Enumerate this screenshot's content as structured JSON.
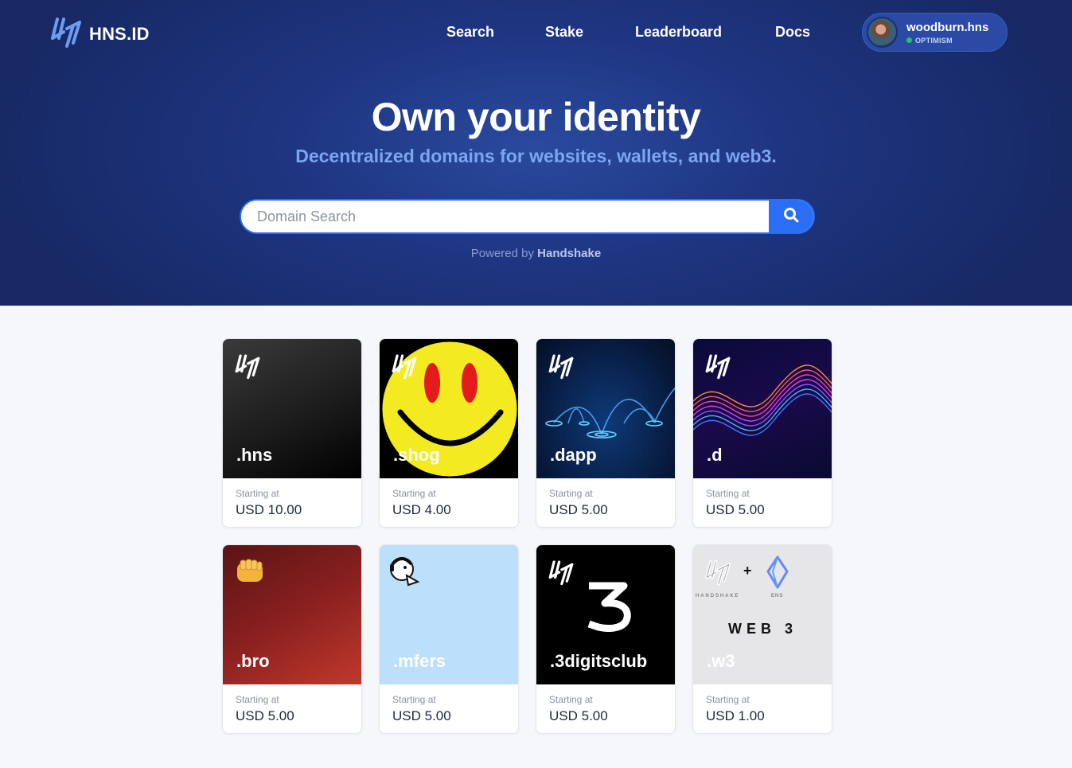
{
  "brand": {
    "name": "HNS.ID",
    "logo_icon": "hns-logo-icon"
  },
  "nav": [
    {
      "label": "Search"
    },
    {
      "label": "Stake"
    },
    {
      "label": "Leaderboard"
    },
    {
      "label": "Docs"
    }
  ],
  "user": {
    "name": "woodburn.hns",
    "network": "OPTIMISM",
    "status_color": "#22c55e"
  },
  "hero": {
    "title": "Own your identity",
    "subtitle": "Decentralized domains for websites, wallets, and web3."
  },
  "search": {
    "placeholder": "Domain Search",
    "button_icon": "search-icon"
  },
  "powered": {
    "prefix": "Powered by",
    "brand": "Handshake"
  },
  "cards": [
    {
      "tld": ".hns",
      "starting_label": "Starting at",
      "price": "USD 10.00",
      "theme": "dark"
    },
    {
      "tld": ".shog",
      "starting_label": "Starting at",
      "price": "USD 4.00",
      "theme": "smiley"
    },
    {
      "tld": ".dapp",
      "starting_label": "Starting at",
      "price": "USD 5.00",
      "theme": "network"
    },
    {
      "tld": ".d",
      "starting_label": "Starting at",
      "price": "USD 5.00",
      "theme": "wave"
    },
    {
      "tld": ".bro",
      "starting_label": "Starting at",
      "price": "USD 5.00",
      "theme": "fist"
    },
    {
      "tld": ".mfers",
      "starting_label": "Starting at",
      "price": "USD 5.00",
      "theme": "mfer"
    },
    {
      "tld": ".3digitsclub",
      "starting_label": "Starting at",
      "price": "USD 5.00",
      "theme": "three"
    },
    {
      "tld": ".w3",
      "starting_label": "Starting at",
      "price": "USD 1.00",
      "theme": "web3",
      "web3_text": "WEB 3",
      "handshake_text": "HANDSHAKE",
      "ens_text": "ENS",
      "plus": "+"
    }
  ],
  "colors": {
    "accent": "#2b6ef6",
    "hero_bg": "#1e3581",
    "subtitle": "#7ea6f0"
  }
}
